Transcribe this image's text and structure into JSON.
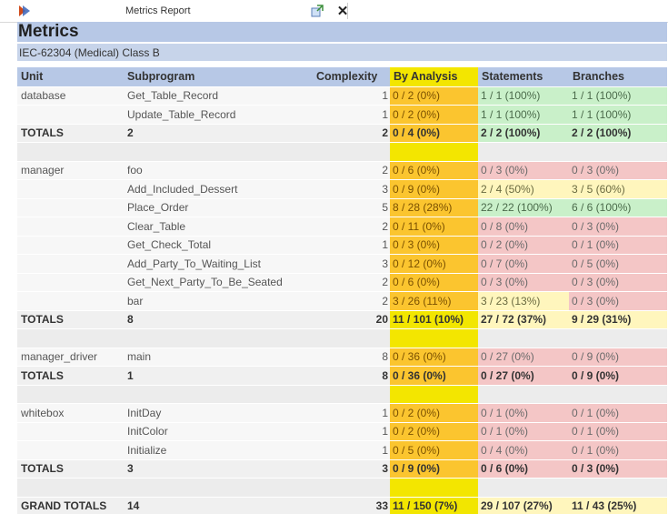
{
  "tab": {
    "title": "Metrics Report",
    "icon": "app-logo-icon",
    "popout_icon": "popout-icon",
    "close_glyph": "✕"
  },
  "report": {
    "heading": "Metrics",
    "standard": "IEC-62304 (Medical) Class B"
  },
  "columns": {
    "unit": "Unit",
    "subprogram": "Subprogram",
    "complexity": "Complexity",
    "by_analysis": "By Analysis",
    "statements": "Statements",
    "branches": "Branches"
  },
  "colors": {
    "header_blue": "#b7c8e6",
    "analysis_yellow": "#f3e600",
    "coverage_orange": "#fbc52f",
    "coverage_red": "#f4c6c6",
    "coverage_green": "#c9f0c9",
    "coverage_light_yellow": "#fff6bd"
  },
  "rows": [
    {
      "kind": "row",
      "unit": "database",
      "subprogram": "Get_Table_Record",
      "complexity": "1",
      "analysis": "0 / 2 (0%)",
      "analysis_color": "orange",
      "statements": "1 / 1 (100%)",
      "statements_color": "green",
      "branches": "1 / 1 (100%)",
      "branches_color": "green"
    },
    {
      "kind": "row",
      "unit": "",
      "subprogram": "Update_Table_Record",
      "complexity": "1",
      "analysis": "0 / 2 (0%)",
      "analysis_color": "orange",
      "statements": "1 / 1 (100%)",
      "statements_color": "green",
      "branches": "1 / 1 (100%)",
      "branches_color": "green"
    },
    {
      "kind": "totals",
      "unit": "TOTALS",
      "subprogram": "2",
      "complexity": "2",
      "analysis": "0 / 4 (0%)",
      "analysis_color": "orange",
      "statements": "2 / 2 (100%)",
      "statements_color": "green",
      "branches": "2 / 2 (100%)",
      "branches_color": "green"
    },
    {
      "kind": "blank"
    },
    {
      "kind": "row",
      "unit": "manager",
      "subprogram": "foo",
      "complexity": "2",
      "analysis": "0 / 6 (0%)",
      "analysis_color": "orange",
      "statements": "0 / 3 (0%)",
      "statements_color": "red",
      "branches": "0 / 3 (0%)",
      "branches_color": "red"
    },
    {
      "kind": "row",
      "unit": "",
      "subprogram": "Add_Included_Dessert",
      "complexity": "3",
      "analysis": "0 / 9 (0%)",
      "analysis_color": "orange",
      "statements": "2 / 4 (50%)",
      "statements_color": "lightyellow",
      "branches": "3 / 5 (60%)",
      "branches_color": "lightyellow"
    },
    {
      "kind": "row",
      "unit": "",
      "subprogram": "Place_Order",
      "complexity": "5",
      "analysis": "8 / 28 (28%)",
      "analysis_color": "orange",
      "statements": "22 / 22 (100%)",
      "statements_color": "green",
      "branches": "6 / 6 (100%)",
      "branches_color": "green"
    },
    {
      "kind": "row",
      "unit": "",
      "subprogram": "Clear_Table",
      "complexity": "2",
      "analysis": "0 / 11 (0%)",
      "analysis_color": "orange",
      "statements": "0 / 8 (0%)",
      "statements_color": "red",
      "branches": "0 / 3 (0%)",
      "branches_color": "red"
    },
    {
      "kind": "row",
      "unit": "",
      "subprogram": "Get_Check_Total",
      "complexity": "1",
      "analysis": "0 / 3 (0%)",
      "analysis_color": "orange",
      "statements": "0 / 2 (0%)",
      "statements_color": "red",
      "branches": "0 / 1 (0%)",
      "branches_color": "red"
    },
    {
      "kind": "row",
      "unit": "",
      "subprogram": "Add_Party_To_Waiting_List",
      "complexity": "3",
      "analysis": "0 / 12 (0%)",
      "analysis_color": "orange",
      "statements": "0 / 7 (0%)",
      "statements_color": "red",
      "branches": "0 / 5 (0%)",
      "branches_color": "red"
    },
    {
      "kind": "row",
      "unit": "",
      "subprogram": "Get_Next_Party_To_Be_Seated",
      "complexity": "2",
      "analysis": "0 / 6 (0%)",
      "analysis_color": "orange",
      "statements": "0 / 3 (0%)",
      "statements_color": "red",
      "branches": "0 / 3 (0%)",
      "branches_color": "red"
    },
    {
      "kind": "row",
      "unit": "",
      "subprogram": "bar",
      "complexity": "2",
      "analysis": "3 / 26 (11%)",
      "analysis_color": "orange",
      "statements": "3 / 23 (13%)",
      "statements_color": "lightyellow",
      "branches": "0 / 3 (0%)",
      "branches_color": "red"
    },
    {
      "kind": "totals",
      "unit": "TOTALS",
      "subprogram": "8",
      "complexity": "20",
      "analysis": "11 / 101 (10%)",
      "analysis_color": "yellow",
      "statements": "27 / 72 (37%)",
      "statements_color": "lightyellow",
      "branches": "9 / 29 (31%)",
      "branches_color": "lightyellow"
    },
    {
      "kind": "blank"
    },
    {
      "kind": "row",
      "unit": "manager_driver",
      "subprogram": "main",
      "complexity": "8",
      "analysis": "0 / 36 (0%)",
      "analysis_color": "orange",
      "statements": "0 / 27 (0%)",
      "statements_color": "red",
      "branches": "0 / 9 (0%)",
      "branches_color": "red"
    },
    {
      "kind": "totals",
      "unit": "TOTALS",
      "subprogram": "1",
      "complexity": "8",
      "analysis": "0 / 36 (0%)",
      "analysis_color": "orange",
      "statements": "0 / 27 (0%)",
      "statements_color": "red",
      "branches": "0 / 9 (0%)",
      "branches_color": "red"
    },
    {
      "kind": "blank"
    },
    {
      "kind": "row",
      "unit": "whitebox",
      "subprogram": "InitDay",
      "complexity": "1",
      "analysis": "0 / 2 (0%)",
      "analysis_color": "orange",
      "statements": "0 / 1 (0%)",
      "statements_color": "red",
      "branches": "0 / 1 (0%)",
      "branches_color": "red"
    },
    {
      "kind": "row",
      "unit": "",
      "subprogram": "InitColor",
      "complexity": "1",
      "analysis": "0 / 2 (0%)",
      "analysis_color": "orange",
      "statements": "0 / 1 (0%)",
      "statements_color": "red",
      "branches": "0 / 1 (0%)",
      "branches_color": "red"
    },
    {
      "kind": "row",
      "unit": "",
      "subprogram": "Initialize",
      "complexity": "1",
      "analysis": "0 / 5 (0%)",
      "analysis_color": "orange",
      "statements": "0 / 4 (0%)",
      "statements_color": "red",
      "branches": "0 / 1 (0%)",
      "branches_color": "red"
    },
    {
      "kind": "totals",
      "unit": "TOTALS",
      "subprogram": "3",
      "complexity": "3",
      "analysis": "0 / 9 (0%)",
      "analysis_color": "orange",
      "statements": "0 / 6 (0%)",
      "statements_color": "red",
      "branches": "0 / 3 (0%)",
      "branches_color": "red"
    },
    {
      "kind": "blank"
    },
    {
      "kind": "grand",
      "unit": "GRAND TOTALS",
      "subprogram": "14",
      "complexity": "33",
      "analysis": "11 / 150 (7%)",
      "analysis_color": "yellow",
      "statements": "29 / 107 (27%)",
      "statements_color": "lightyellow",
      "branches": "11 / 43 (25%)",
      "branches_color": "lightyellow"
    }
  ]
}
